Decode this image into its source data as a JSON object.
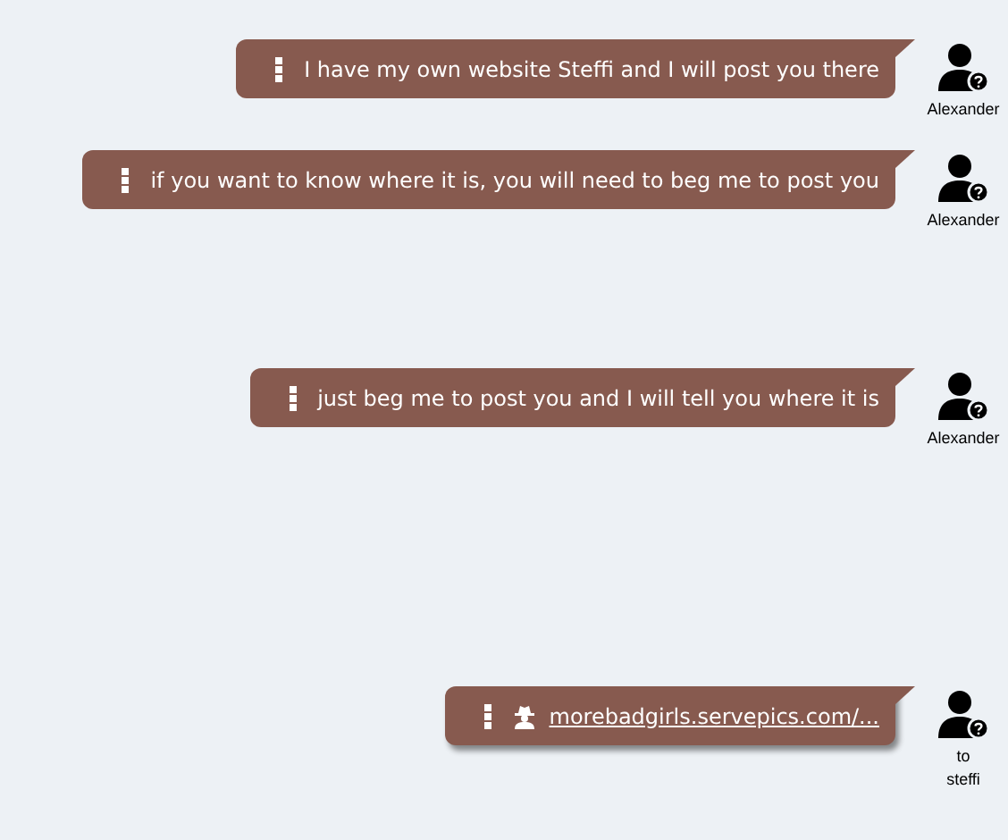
{
  "messages": [
    {
      "kind": "text",
      "text": "I have my own website Steffi and I will post you there",
      "sender": "Alexander"
    },
    {
      "kind": "text",
      "text": "if you want to know where it is, you will need to beg me to post you",
      "sender": "Alexander"
    },
    {
      "kind": "text",
      "text": "just beg me to post you and I will tell you where it is",
      "sender": "Alexander"
    },
    {
      "kind": "link",
      "text": "morebadgirls.servepics.com/...",
      "sender": "to steffi"
    }
  ]
}
